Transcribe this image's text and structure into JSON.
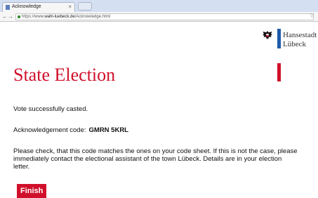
{
  "browser": {
    "tab_title": "Acknowledge",
    "tab_close": "×",
    "new_tab": "+",
    "url_prefix": "https://www.",
    "url_host": "wahl-luebeck.de",
    "url_path": "/Acknowledge.html",
    "back_icon": "←",
    "forward_icon": "→",
    "menu_icon": "▽"
  },
  "header": {
    "logo_text": "Hansestadt\nLübeck",
    "colors": {
      "blue": "#1e5aa8",
      "red": "#d0102b"
    }
  },
  "main": {
    "title": "State Election",
    "success_message": "Vote successfully casted.",
    "ack_label": "Acknowledgement code:",
    "ack_code": "GMRN 5KRL",
    "instructions": "Please check, that this code matches the ones on your code sheet. If this is not the case, please immediately contact the electional assistant of the town Lübeck. Details are in your election letter.",
    "finish_label": "Finish"
  }
}
